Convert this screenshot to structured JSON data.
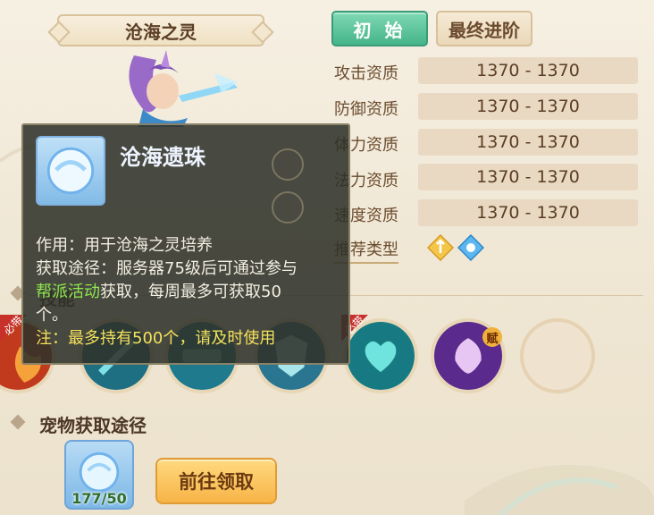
{
  "pet": {
    "name": "沧海之灵"
  },
  "tabs": {
    "initial": "初 始",
    "final": "最终进阶"
  },
  "stats": [
    {
      "label": "攻击资质",
      "value": "1370 - 1370"
    },
    {
      "label": "防御资质",
      "value": "1370 - 1370"
    },
    {
      "label": "体力资质",
      "value": "1370 - 1370"
    },
    {
      "label": "法力资质",
      "value": "1370 - 1370"
    },
    {
      "label": "速度资质",
      "value": "1370 - 1370"
    }
  ],
  "recommend": {
    "label": "推荐类型",
    "icons": [
      "attack-type-icon",
      "magic-type-icon"
    ]
  },
  "skills": {
    "badge_must": "必带",
    "badge_talent": "赋",
    "items": [
      "fire-skill-icon",
      "sword-skill-icon",
      "water-skill-icon",
      "shield-skill-icon",
      "heart-skill-icon",
      "mask-skill-icon",
      "empty-slot"
    ]
  },
  "acquire": {
    "title": "宠物获取途径",
    "item_count": "177/50",
    "go_button": "前往领取"
  },
  "tooltip": {
    "title": "沧海遗珠",
    "usage": "作用：用于沧海之灵培养",
    "source_line1": "获取途径：服务器75级后可通过参与",
    "source_green": "帮派活动",
    "source_line2": "获取，每周最多可获取50",
    "source_line3": "个。",
    "note": "注：最多持有500个，请及时使用",
    "hidden_section": "技能"
  },
  "colors": {
    "accent_green": "#45b58a",
    "highlight_green": "#8ee84e",
    "note_yellow": "#f4e15c",
    "button_orange": "#f7b447"
  }
}
